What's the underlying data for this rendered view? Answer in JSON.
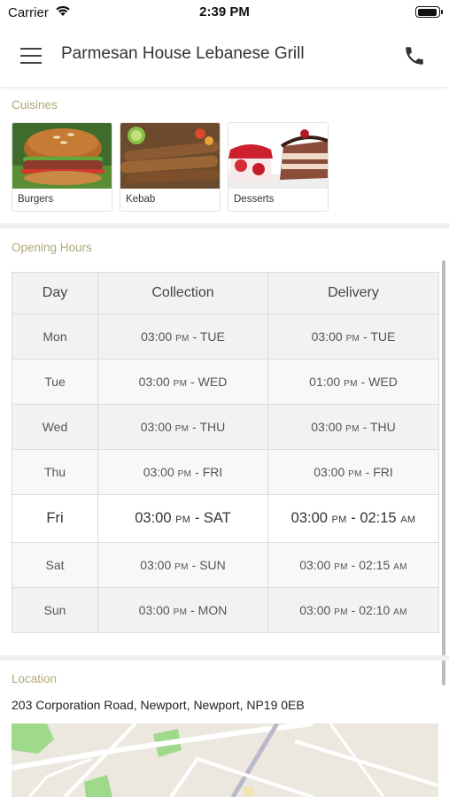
{
  "status_bar": {
    "carrier": "Carrier",
    "time": "2:39 PM"
  },
  "header": {
    "title": "Parmesan House Lebanese Grill",
    "menu_icon": "hamburger-menu-icon",
    "call_icon": "phone-icon"
  },
  "cuisines": {
    "label": "Cuisines",
    "items": [
      {
        "name": "Burgers"
      },
      {
        "name": "Kebab"
      },
      {
        "name": "Desserts"
      }
    ]
  },
  "opening_hours": {
    "label": "Opening Hours",
    "columns": [
      "Day",
      "Collection",
      "Delivery"
    ],
    "rows": [
      {
        "day": "Mon",
        "collection": {
          "time": "03:00",
          "suffix": "PM",
          "end": " - TUE",
          "end_suffix": ""
        },
        "delivery": {
          "time": "03:00",
          "suffix": "PM",
          "end": " - TUE",
          "end_suffix": ""
        }
      },
      {
        "day": "Tue",
        "collection": {
          "time": "03:00",
          "suffix": "PM",
          "end": " - WED",
          "end_suffix": ""
        },
        "delivery": {
          "time": "01:00",
          "suffix": "PM",
          "end": " - WED",
          "end_suffix": ""
        }
      },
      {
        "day": "Wed",
        "collection": {
          "time": "03:00",
          "suffix": "PM",
          "end": " - THU",
          "end_suffix": ""
        },
        "delivery": {
          "time": "03:00",
          "suffix": "PM",
          "end": " - THU",
          "end_suffix": ""
        }
      },
      {
        "day": "Thu",
        "collection": {
          "time": "03:00",
          "suffix": "PM",
          "end": " - FRI",
          "end_suffix": ""
        },
        "delivery": {
          "time": "03:00",
          "suffix": "PM",
          "end": " - FRI",
          "end_suffix": ""
        }
      },
      {
        "day": "Fri",
        "collection": {
          "time": "03:00",
          "suffix": "PM",
          "end": " - SAT",
          "end_suffix": ""
        },
        "delivery": {
          "time": "03:00",
          "suffix": "PM",
          "end": " - 02:15",
          "end_suffix": "AM"
        }
      },
      {
        "day": "Sat",
        "collection": {
          "time": "03:00",
          "suffix": "PM",
          "end": " - SUN",
          "end_suffix": ""
        },
        "delivery": {
          "time": "03:00",
          "suffix": "PM",
          "end": " - 02:15",
          "end_suffix": "AM"
        }
      },
      {
        "day": "Sun",
        "collection": {
          "time": "03:00",
          "suffix": "PM",
          "end": " - MON",
          "end_suffix": ""
        },
        "delivery": {
          "time": "03:00",
          "suffix": "PM",
          "end": " - 02:10",
          "end_suffix": "AM"
        }
      }
    ]
  },
  "location": {
    "label": "Location",
    "address": "203 Corporation Road, Newport, Newport, NP19 0EB"
  },
  "colors": {
    "section_label": "#b0a878",
    "divider": "#efefef",
    "map_green": "#9fd98a",
    "map_road": "#ffffff"
  }
}
